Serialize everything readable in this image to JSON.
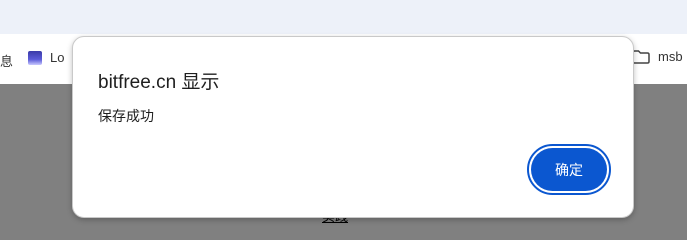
{
  "browser": {
    "bookmarks": {
      "left_fragment": "息",
      "item_lo": "Lo",
      "item_msb": "msb"
    }
  },
  "page": {
    "underlying_link": "实践"
  },
  "dialog": {
    "title": "bitfree.cn 显示",
    "message": "保存成功",
    "ok_label": "确定"
  },
  "colors": {
    "accent": "#0b57d0",
    "overlay": "#808080",
    "toolbar": "#edf1f9"
  }
}
